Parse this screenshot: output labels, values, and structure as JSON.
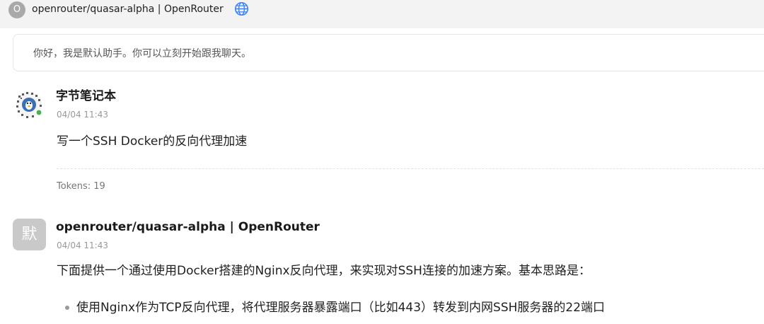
{
  "header": {
    "avatar_letter": "O",
    "title": "openrouter/quasar-alpha | OpenRouter",
    "globe_icon": "globe-icon"
  },
  "welcome": {
    "text": "你好，我是默认助手。你可以立刻开始跟我聊天。"
  },
  "messages": [
    {
      "role": "user",
      "name": "字节笔记本",
      "time": "04/04 11:43",
      "body": "写一个SSH Docker的反向代理加速",
      "tokens": "Tokens: 19"
    },
    {
      "role": "assistant",
      "avatar_char": "默",
      "name": "openrouter/quasar-alpha | OpenRouter",
      "time": "04/04 11:43",
      "body": "下面提供一个通过使用Docker搭建的Nginx反向代理，来实现对SSH连接的加速方案。基本思路是：",
      "bullets": [
        "使用Nginx作为TCP反向代理，将代理服务器暴露端口（比如443）转发到内网SSH服务器的22端口"
      ]
    }
  ],
  "colors": {
    "topbar_bg": "#f3f3f3",
    "accent_globe": "#3b82f6",
    "online_dot": "#4caf50"
  }
}
